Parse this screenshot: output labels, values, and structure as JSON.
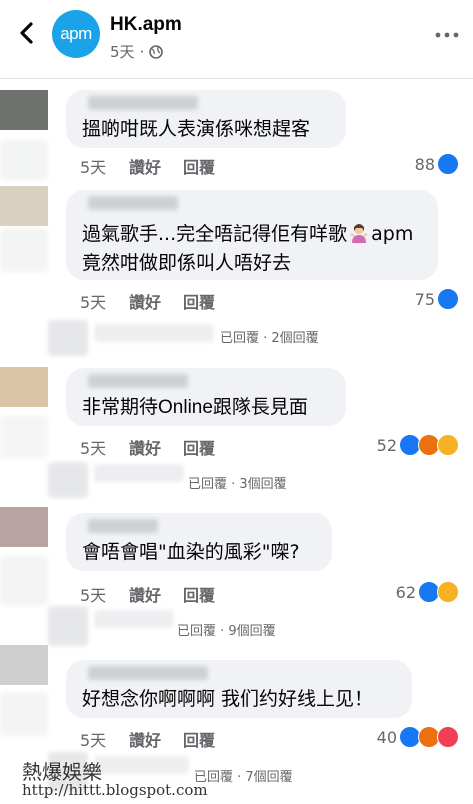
{
  "header": {
    "page_name": "HK.apm",
    "time": "5天",
    "logo_text": "apm",
    "back_icon": "chevron-left-icon",
    "more_icon": "more-horizontal-icon",
    "privacy_icon": "globe-icon"
  },
  "actions": {
    "like": "讚好",
    "reply": "回覆"
  },
  "comments": [
    {
      "text": "搵啲咁既人表演係咪想趕客",
      "time": "5天",
      "count": "88",
      "reactions": [
        "like"
      ]
    },
    {
      "text": "過氣歌手...完全唔記得佢有咩歌",
      "text_end": "apm",
      "text2": "竟然咁做即係叫人唔好去",
      "time": "5天",
      "count": "75",
      "reactions": [
        "like"
      ],
      "emoji": "person-shrugging-icon"
    },
    {
      "text": "非常期待Online跟隊長見面",
      "time": "5天",
      "count": "52",
      "reactions": [
        "like",
        "angry",
        "haha"
      ]
    },
    {
      "text": "會唔會唱\"血染的風彩\"㗎?",
      "time": "5天",
      "count": "62",
      "reactions": [
        "like",
        "haha"
      ]
    },
    {
      "text": "好想念你啊啊啊 我们约好线上见！",
      "time": "5天",
      "count": "40",
      "reactions": [
        "like",
        "angry",
        "heart"
      ]
    }
  ],
  "replies": [
    {
      "text": "已回覆 · 2個回覆"
    },
    {
      "text": "已回覆 · 3個回覆"
    },
    {
      "text": "已回覆 · 9個回覆"
    },
    {
      "text": "已回覆 · 7個回覆"
    }
  ],
  "watermark": {
    "title": "熱爆娛樂",
    "url": "http://hittt.blogspot.com"
  },
  "colors": {
    "accent": "#1877f2",
    "logo": "#1aa3e8",
    "bubble": "#f0f2f5",
    "muted": "#65676b"
  }
}
